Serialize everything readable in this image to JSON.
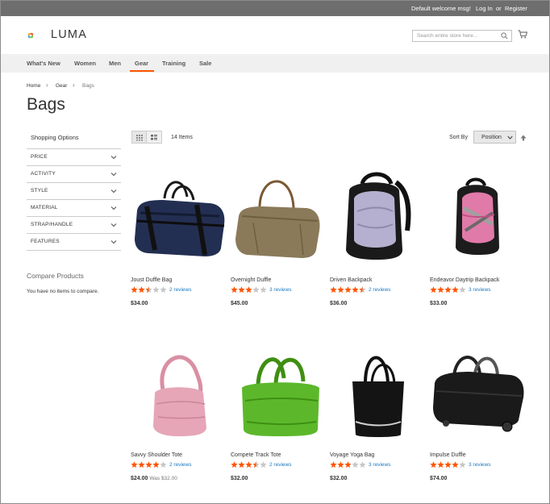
{
  "topbar": {
    "welcome": "Default welcome msg!",
    "login": "Log In",
    "or": "or",
    "register": "Register"
  },
  "header": {
    "logo_text": "LUMA",
    "search_placeholder": "Search entire store here..."
  },
  "nav": {
    "items": [
      "What's New",
      "Women",
      "Men",
      "Gear",
      "Training",
      "Sale"
    ],
    "active": "Gear"
  },
  "breadcrumb": [
    "Home",
    "Gear",
    "Bags"
  ],
  "page_title": "Bags",
  "sidebar": {
    "shopping_options": "Shopping Options",
    "filters": [
      "PRICE",
      "ACTIVITY",
      "STYLE",
      "MATERIAL",
      "STRAP/HANDLE",
      "FEATURES"
    ],
    "compare_title": "Compare Products",
    "compare_text": "You have no items to compare."
  },
  "toolbar": {
    "items_count": "14 Items",
    "sort_label": "Sort By",
    "sort_value": "Position"
  },
  "colors": {
    "accent": "#ff5501",
    "star": "#ff5501",
    "link": "#1979c3",
    "topbar": "#6e6e6e"
  },
  "products": [
    {
      "name": "Joust Duffle Bag",
      "rating_stars": 2.5,
      "reviews": "2 reviews",
      "price": "$34.00",
      "was": "",
      "icon": "duffle-bag"
    },
    {
      "name": "Overnight Duffle",
      "rating_stars": 3,
      "reviews": "3 reviews",
      "price": "$45.00",
      "was": "",
      "icon": "tan-duffle"
    },
    {
      "name": "Driven Backpack",
      "rating_stars": 4.5,
      "reviews": "2 reviews",
      "price": "$36.00",
      "was": "",
      "icon": "lavender-backpack"
    },
    {
      "name": "Endeavor Daytrip Backpack",
      "rating_stars": 4,
      "reviews": "3 reviews",
      "price": "$33.00",
      "was": "",
      "icon": "pink-backpack"
    },
    {
      "name": "Savvy Shoulder Tote",
      "rating_stars": 4,
      "reviews": "2 reviews",
      "price": "$24.00",
      "was": "Was $32.00",
      "icon": "pink-shoulder-tote"
    },
    {
      "name": "Compete Track Tote",
      "rating_stars": 3.5,
      "reviews": "2 reviews",
      "price": "$32.00",
      "was": "",
      "icon": "green-tote"
    },
    {
      "name": "Voyage Yoga Bag",
      "rating_stars": 3,
      "reviews": "3 reviews",
      "price": "$32.00",
      "was": "",
      "icon": "black-yoga-bag"
    },
    {
      "name": "Impulse Duffle",
      "rating_stars": 4,
      "reviews": "3 reviews",
      "price": "$74.00",
      "was": "",
      "icon": "wheeled-duffle"
    }
  ]
}
